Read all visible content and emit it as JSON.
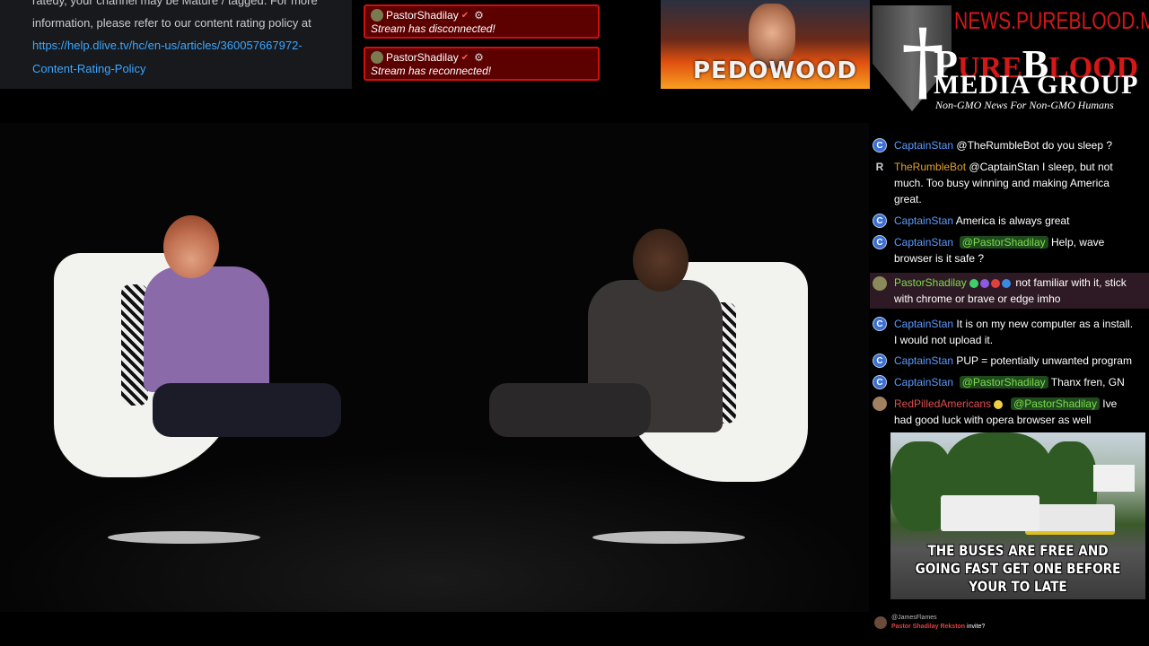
{
  "info": {
    "line1": "ratedy, your channel may be Mature / tagged. For more",
    "line2": "information, please refer to our content rating policy at",
    "link1": "https://help.dlive.tv/hc/en-us/articles/360057667972-",
    "link2": "Content-Rating-Policy"
  },
  "alerts": [
    {
      "user": "PastorShadilay",
      "message": "Stream has disconnected!"
    },
    {
      "user": "PastorShadilay",
      "message": "Stream has reconnected!"
    }
  ],
  "thumbnail": {
    "text": "PEDOWOOD"
  },
  "logo": {
    "url": "NEWS.PUREBLOOD.MEDIA",
    "line1_big": "P",
    "line1_rest": "URE",
    "line1_b": "B",
    "line1_end": "LOOD",
    "line2": "MEDIA GROUP",
    "tagline": "Non-GMO News For Non-GMO Humans"
  },
  "chat": {
    "messages": [
      {
        "badge": "C",
        "user": "CaptainStan",
        "pre": "",
        "mention": "@TheRumbleBot",
        "text": " do you sleep ?"
      },
      {
        "badge": "R",
        "user": "TheRumbleBot",
        "pre": "",
        "mention": "@CaptainStan",
        "text": " I sleep, but not much. Too busy winning and making America great."
      },
      {
        "badge": "C",
        "user": "CaptainStan",
        "pre": "",
        "mention": "",
        "text": " America is always great"
      },
      {
        "badge": "C",
        "user": "CaptainStan",
        "pre": "",
        "mention": "@PastorShadilay",
        "text": " Help, wave browser is it safe ?"
      },
      {
        "badge": "",
        "user": "PastorShadilay",
        "pre": "",
        "mention": "",
        "text": " not familiar with it, stick with chrome or brave or edge imho"
      },
      {
        "badge": "C",
        "user": "CaptainStan",
        "pre": "",
        "mention": "",
        "text": " It is on my new computer as a install. I would not upload it."
      },
      {
        "badge": "C",
        "user": "CaptainStan",
        "pre": "",
        "mention": "",
        "text": " PUP = potentially unwanted program"
      },
      {
        "badge": "C",
        "user": "CaptainStan",
        "pre": "",
        "mention": "@PastorShadilay",
        "text": " Thanx fren, GN"
      },
      {
        "badge": "",
        "user": "RedPilledAmericans",
        "pre": "",
        "mention": "@PastorShadilay",
        "text": " Ive had good luck with opera browser as well"
      }
    ]
  },
  "meme": {
    "caption": "THE BUSES ARE FREE AND GOING FAST GET ONE BEFORE YOUR TO LATE"
  },
  "footer": {
    "line1": "@JamesFlames",
    "line2": "Pastor Shadilay Rekston",
    "line2_end": " invite?"
  },
  "colors": {
    "accent_red": "#d41717",
    "link": "#3ea6ff",
    "captain": "#5b9bff",
    "pastor": "#7ddc4a"
  }
}
